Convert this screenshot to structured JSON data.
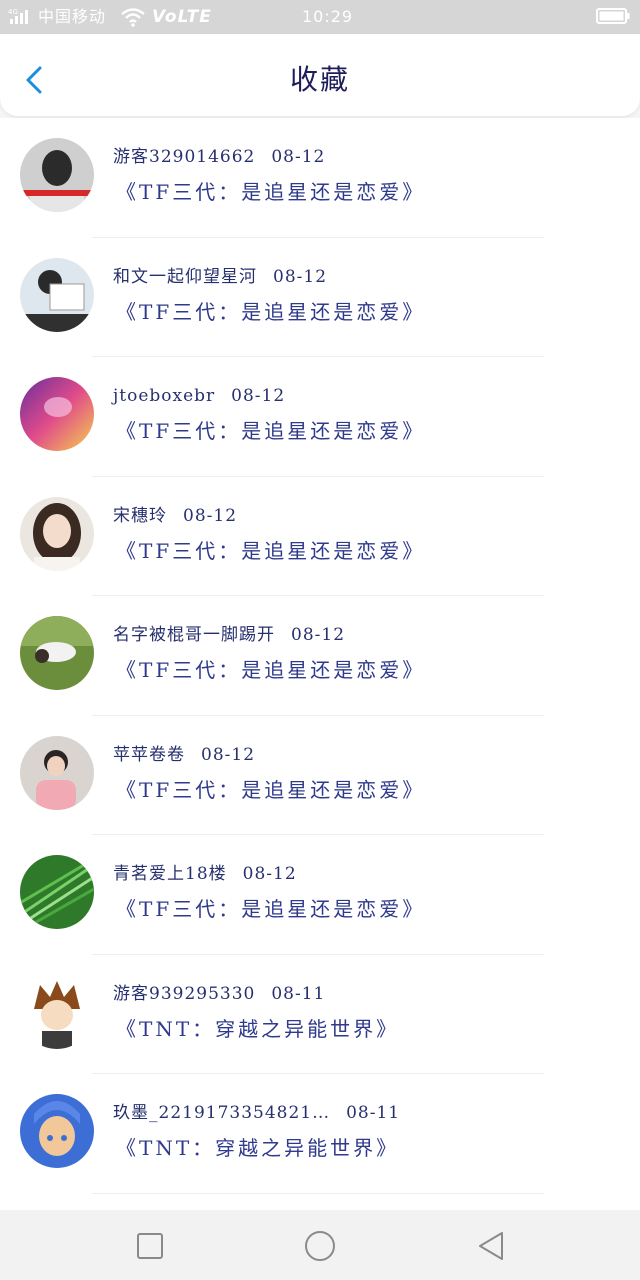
{
  "status_bar": {
    "network": "4G",
    "carrier": "中国移动",
    "volte": "VoLTE",
    "time": "10:29"
  },
  "header": {
    "title": "收藏"
  },
  "favorites": [
    {
      "author": "游客329014662",
      "date": "08-12",
      "title": "《TF三代：是追星还是恋爱》"
    },
    {
      "author": "和文一起仰望星河",
      "date": "08-12",
      "title": "《TF三代：是追星还是恋爱》"
    },
    {
      "author": "jtoeboxebr",
      "date": "08-12",
      "title": "《TF三代：是追星还是恋爱》"
    },
    {
      "author": "宋穗玲",
      "date": "08-12",
      "title": "《TF三代：是追星还是恋爱》"
    },
    {
      "author": "名字被棍哥一脚踢开",
      "date": "08-12",
      "title": "《TF三代：是追星还是恋爱》"
    },
    {
      "author": "苹苹卷卷",
      "date": "08-12",
      "title": "《TF三代：是追星还是恋爱》"
    },
    {
      "author": "青茗爱上18楼",
      "date": "08-12",
      "title": "《TF三代：是追星还是恋爱》"
    },
    {
      "author": "游客939295330",
      "date": "08-11",
      "title": "《TNT：穿越之异能世界》"
    },
    {
      "author": "玖墨_2219173354821…",
      "date": "08-11",
      "title": "《TNT：穿越之异能世界》"
    }
  ],
  "colors": {
    "accent": "#1a8fe0",
    "text_primary": "#27306e",
    "status_bar_bg": "#d6d6d6"
  },
  "icons": {
    "back": "chevron-left-icon",
    "nav_recents": "square-icon",
    "nav_home": "circle-icon",
    "nav_back": "triangle-left-icon"
  }
}
